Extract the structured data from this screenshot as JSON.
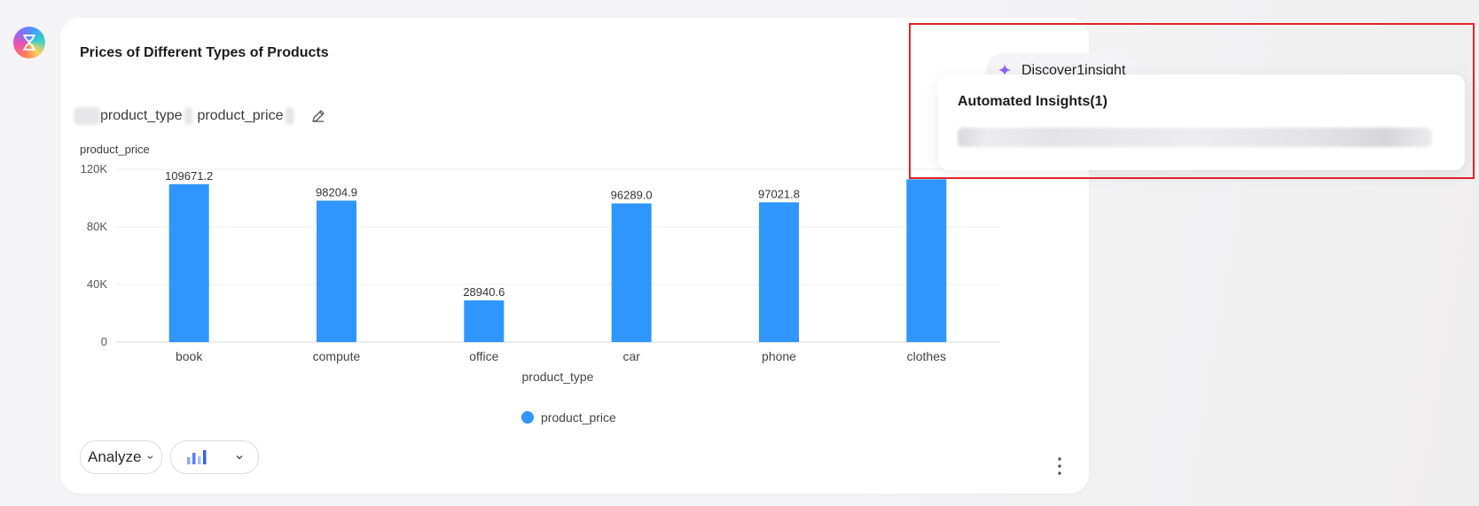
{
  "card": {
    "title": "Prices of Different Types of Products",
    "query_tokens": [
      "product_type",
      "product_price"
    ]
  },
  "discover": {
    "label": "Discover1insight"
  },
  "insight_panel": {
    "title": "Automated Insights(1)"
  },
  "chart_data": {
    "type": "bar",
    "categories": [
      "book",
      "compute",
      "office",
      "car",
      "phone",
      "clothes"
    ],
    "series": [
      {
        "name": "product_price",
        "values": [
          109671.2,
          98204.9,
          28940.6,
          96289.0,
          97021.8,
          113000
        ]
      }
    ],
    "data_labels": [
      "109671.2",
      "98204.9",
      "28940.6",
      "96289.0",
      "97021.8",
      ""
    ],
    "ylabel": "product_price",
    "xlabel": "product_type",
    "yticks": [
      "0",
      "40K",
      "80K",
      "120K"
    ],
    "ytick_values": [
      0,
      40000,
      80000,
      120000
    ],
    "ylim": [
      0,
      120000
    ],
    "grid": true,
    "legend_position": "bottom-center",
    "bar_color": "#2f95ff"
  },
  "controls": {
    "analyze_label": "Analyze"
  },
  "colors": {
    "accent": "#2f95ff",
    "highlight": "#e2222a"
  }
}
